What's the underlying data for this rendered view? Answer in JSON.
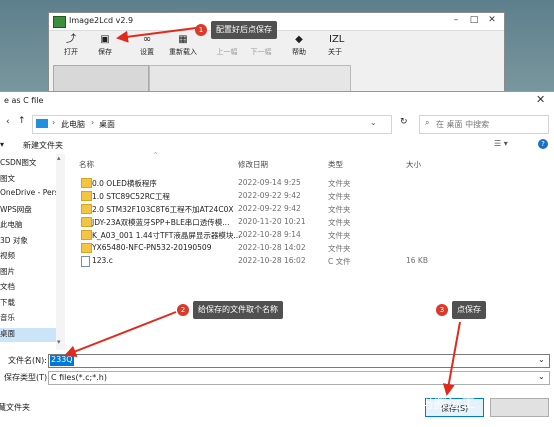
{
  "app": {
    "title": "Image2Lcd v2.9",
    "toolbar": [
      {
        "label": "打开",
        "icon": "open-icon",
        "glyph": "⤴",
        "disabled": false
      },
      {
        "label": "保存",
        "icon": "save-icon",
        "glyph": "▣",
        "disabled": false
      },
      {
        "label": "设置",
        "icon": "settings-icon",
        "glyph": "∞",
        "disabled": false
      },
      {
        "label": "重新载入",
        "icon": "reload-icon",
        "glyph": "▦",
        "disabled": false
      },
      {
        "label": "上一幅",
        "icon": "prev-image-icon",
        "glyph": "",
        "disabled": true
      },
      {
        "label": "下一幅",
        "icon": "next-image-icon",
        "glyph": "",
        "disabled": true
      },
      {
        "label": "帮助",
        "icon": "help-icon",
        "glyph": "◆",
        "disabled": false
      },
      {
        "label": "关于",
        "icon": "about-icon",
        "glyph": "IZL",
        "disabled": false
      }
    ]
  },
  "dialog": {
    "title": "e as C file",
    "breadcrumb": [
      "此电脑",
      "桌面"
    ],
    "search_placeholder": "在 桌面 中搜索",
    "new_folder": "新建文件夹",
    "sidebar": [
      {
        "label": "CSDN图文",
        "selected": false
      },
      {
        "label": "图文",
        "selected": false
      },
      {
        "label": "OneDrive - Pers",
        "selected": false
      },
      {
        "label": "WPS网盘",
        "selected": false
      },
      {
        "label": "此电脑",
        "selected": false
      },
      {
        "label": "3D 对象",
        "selected": false
      },
      {
        "label": "视频",
        "selected": false
      },
      {
        "label": "图片",
        "selected": false
      },
      {
        "label": "文档",
        "selected": false
      },
      {
        "label": "下载",
        "selected": false
      },
      {
        "label": "音乐",
        "selected": false
      },
      {
        "label": "桌面",
        "selected": true
      }
    ],
    "columns": {
      "name": "名称",
      "date": "修改日期",
      "type": "类型",
      "size": "大小"
    },
    "files": [
      {
        "name": "0.0 OLED横板程序",
        "date": "2022-09-14 9:25",
        "type": "文件夹",
        "size": "",
        "kind": "folder"
      },
      {
        "name": "1.0 STC89C52RC工程",
        "date": "2022-09-22 9:42",
        "type": "文件夹",
        "size": "",
        "kind": "folder"
      },
      {
        "name": "2.0 STM32F103C8T6工程不加AT24C0X",
        "date": "2022-09-22 9:42",
        "type": "文件夹",
        "size": "",
        "kind": "folder"
      },
      {
        "name": "JDY-23A双模蓝牙SPP+BLE串口透传模...",
        "date": "2020-11-20 10:21",
        "type": "文件夹",
        "size": "",
        "kind": "folder"
      },
      {
        "name": "K_A03_001 1.44寸TFT液晶屏显示器模块...",
        "date": "2022-10-28 9:14",
        "type": "文件夹",
        "size": "",
        "kind": "folder"
      },
      {
        "name": "YX65480-NFC-PN532-20190509",
        "date": "2022-10-28 14:02",
        "type": "文件夹",
        "size": "",
        "kind": "folder"
      },
      {
        "name": "123.c",
        "date": "2022-10-28 16:02",
        "type": "C 文件",
        "size": "16 KB",
        "kind": "file"
      }
    ],
    "filename_label": "文件名(N):",
    "filename_value": "233Q",
    "filetype_label": "保存类型(T):",
    "filetype_value": "C files(*.c;*.h)",
    "hide_folders": "藏文件夹",
    "save_button": "保存(S)",
    "cancel_button": ""
  },
  "annotations": [
    {
      "num": "1",
      "text": "配置好后点保存"
    },
    {
      "num": "2",
      "text": "给保存的文件取个名称"
    },
    {
      "num": "3",
      "text": "点保存"
    }
  ],
  "watermark": "CSDN @单片机代码搬运工",
  "colors": {
    "callout_bg": "#505050",
    "badge": "#d93a2b",
    "arrow": "#e02a1c",
    "selection": "#0078d7"
  }
}
